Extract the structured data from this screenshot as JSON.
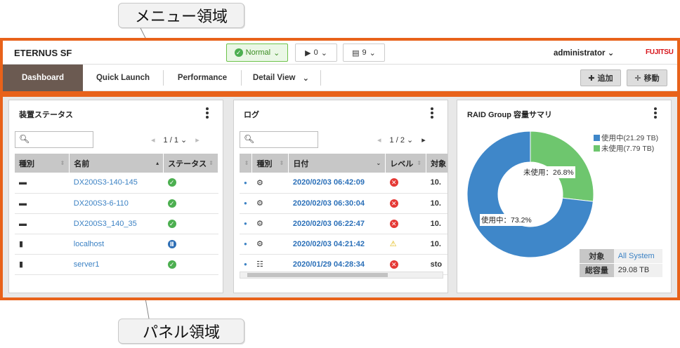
{
  "annotations": {
    "menu_area": "メニュー領域",
    "panel_area": "パネル領域"
  },
  "header": {
    "brand": "ETERNUS SF",
    "status": "Normal",
    "jobs_count": "0",
    "events_count": "9",
    "user": "administrator",
    "logo": "FUJITSU"
  },
  "nav": {
    "tabs": [
      "Dashboard",
      "Quick Launch",
      "Performance",
      "Detail View"
    ],
    "active": "Dashboard",
    "add_label": "追加",
    "move_label": "移動"
  },
  "device_panel": {
    "title": "装置ステータス",
    "page": "1 / 1",
    "columns": [
      "種別",
      "名前",
      "ステータス"
    ],
    "rows": [
      {
        "name": "DX200S3-140-145",
        "status": "ok"
      },
      {
        "name": "DX200S3-6-110",
        "status": "ok"
      },
      {
        "name": "DX200S3_140_35",
        "status": "ok"
      },
      {
        "name": "localhost",
        "status": "paused"
      },
      {
        "name": "server1",
        "status": "ok"
      }
    ]
  },
  "log_panel": {
    "title": "ログ",
    "page": "1 / 2",
    "columns": [
      "種別",
      "日付",
      "レベル",
      "対象"
    ],
    "rows": [
      {
        "date": "2020/02/03 06:42:09",
        "level": "error",
        "target": "10."
      },
      {
        "date": "2020/02/03 06:30:04",
        "level": "error",
        "target": "10."
      },
      {
        "date": "2020/02/03 06:22:47",
        "level": "error",
        "target": "10."
      },
      {
        "date": "2020/02/03 04:21:42",
        "level": "warning",
        "target": "10."
      },
      {
        "date": "2020/01/29 04:28:34",
        "level": "error",
        "target": "sto"
      }
    ]
  },
  "raid_panel": {
    "title": "RAID Group 容量サマリ",
    "legend": [
      "使用中(21.29 TB)",
      "未使用(7.79 TB)"
    ],
    "used_label": "使用中：73.2%",
    "unused_label": "未使用：26.8%",
    "summary": [
      {
        "k": "対象",
        "v": "All System"
      },
      {
        "k": "総容量",
        "v": "29.08 TB"
      }
    ]
  },
  "chart_data": {
    "type": "pie",
    "categories": [
      "使用中",
      "未使用"
    ],
    "values": [
      73.2,
      26.8
    ],
    "colors": [
      "#3f87c9",
      "#6ec66e"
    ]
  }
}
